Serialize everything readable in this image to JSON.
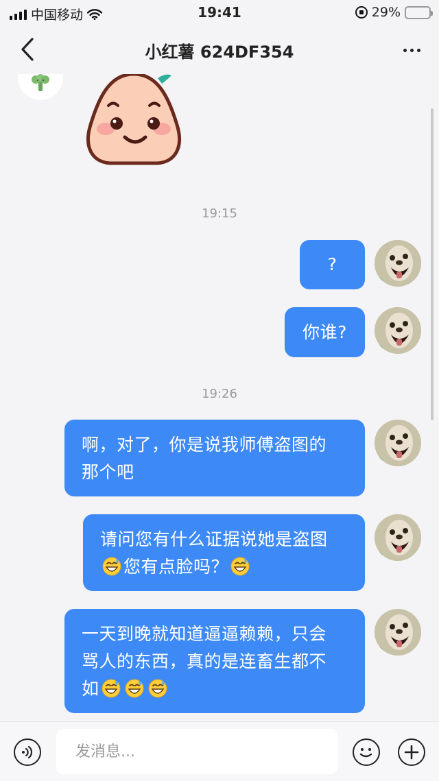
{
  "status_bar": {
    "carrier": "中国移动",
    "time": "19:41",
    "battery_percent": "29%",
    "battery_level": 0.29
  },
  "header": {
    "title": "小红薯 624DF354"
  },
  "messages": {
    "timestamp_1": "19:15",
    "m1": "?",
    "m2": "你谁?",
    "timestamp_2": "19:26",
    "m3": [
      "啊，对了，你是说我师傅盗图的",
      "那个吧"
    ],
    "m4_line1": "请问您有什么证据说她是盗图",
    "m4_line2_text": "您有点脸吗？",
    "m5_line1": "一天到晚就知道逼逼赖赖，只会",
    "m5_line2": "骂人的东西，真的是连畜生都不",
    "m5_line3_text": "如"
  },
  "icons": {
    "back": "chevron-left-icon",
    "more": "more-dots-icon",
    "sweat_emoji": "grinning-sweat-emoji",
    "voice": "voice-icon",
    "emoji": "smiley-icon",
    "plus": "plus-icon"
  },
  "colors": {
    "bubble_self": "#3d8af7",
    "background": "#f4f4f6",
    "battery_fill": "#f5c518"
  },
  "input": {
    "placeholder": "发消息..."
  }
}
